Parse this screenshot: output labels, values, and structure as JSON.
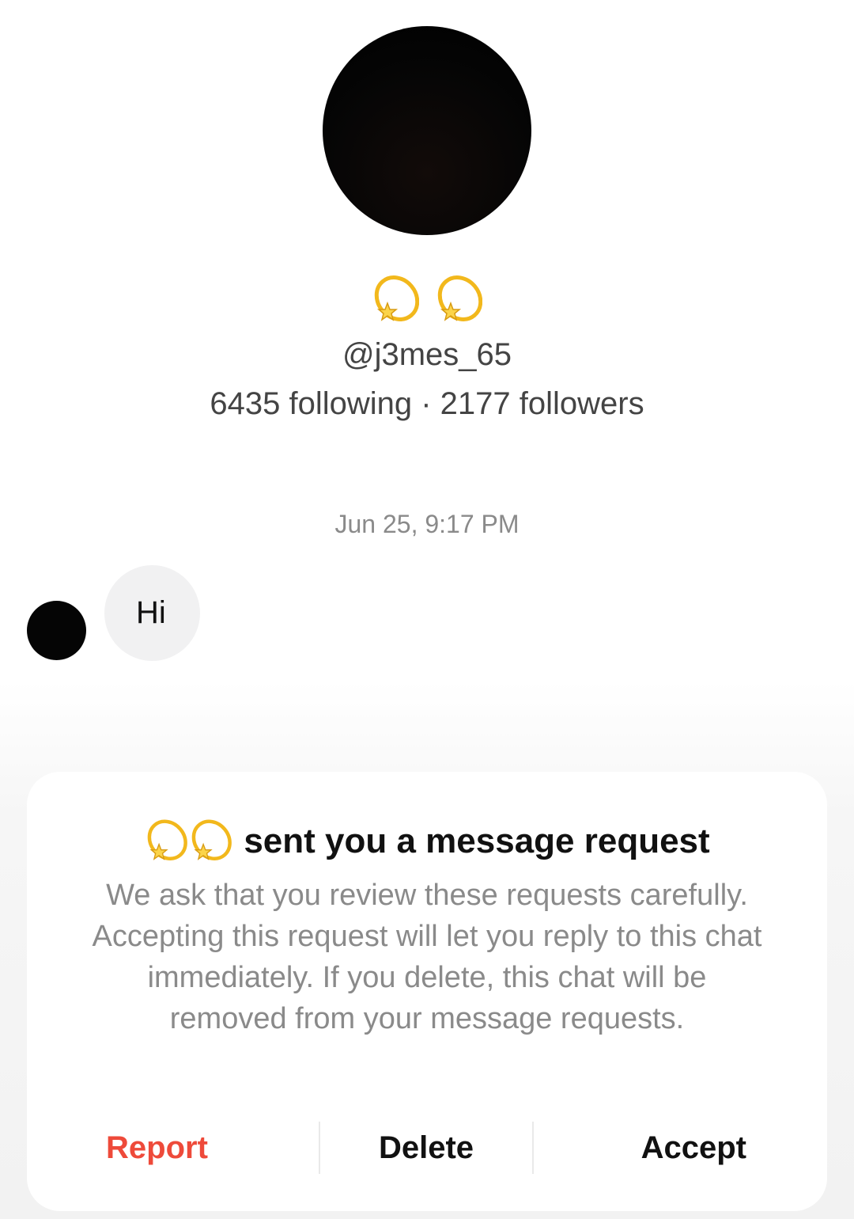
{
  "profile": {
    "display_name_icons": [
      "dizzy-emoji-icon",
      "dizzy-emoji-icon"
    ],
    "handle": "@j3mes_65",
    "stats": "6435 following · 2177 followers"
  },
  "conversation": {
    "timestamp": "Jun 25, 9:17 PM",
    "messages": [
      {
        "text": "Hi"
      }
    ]
  },
  "request_panel": {
    "title_icons": [
      "dizzy-emoji-icon",
      "dizzy-emoji-icon"
    ],
    "title": "sent you a message request",
    "body": "We ask that you review these requests carefully. Accepting this request will let you reply to this chat immediately. If you delete, this chat will be removed from your message requests.",
    "actions": {
      "report": "Report",
      "delete": "Delete",
      "accept": "Accept"
    }
  },
  "colors": {
    "report": "#ee4a3a",
    "bubble": "#f1f1f2",
    "muted_text": "#8a8a8a"
  }
}
